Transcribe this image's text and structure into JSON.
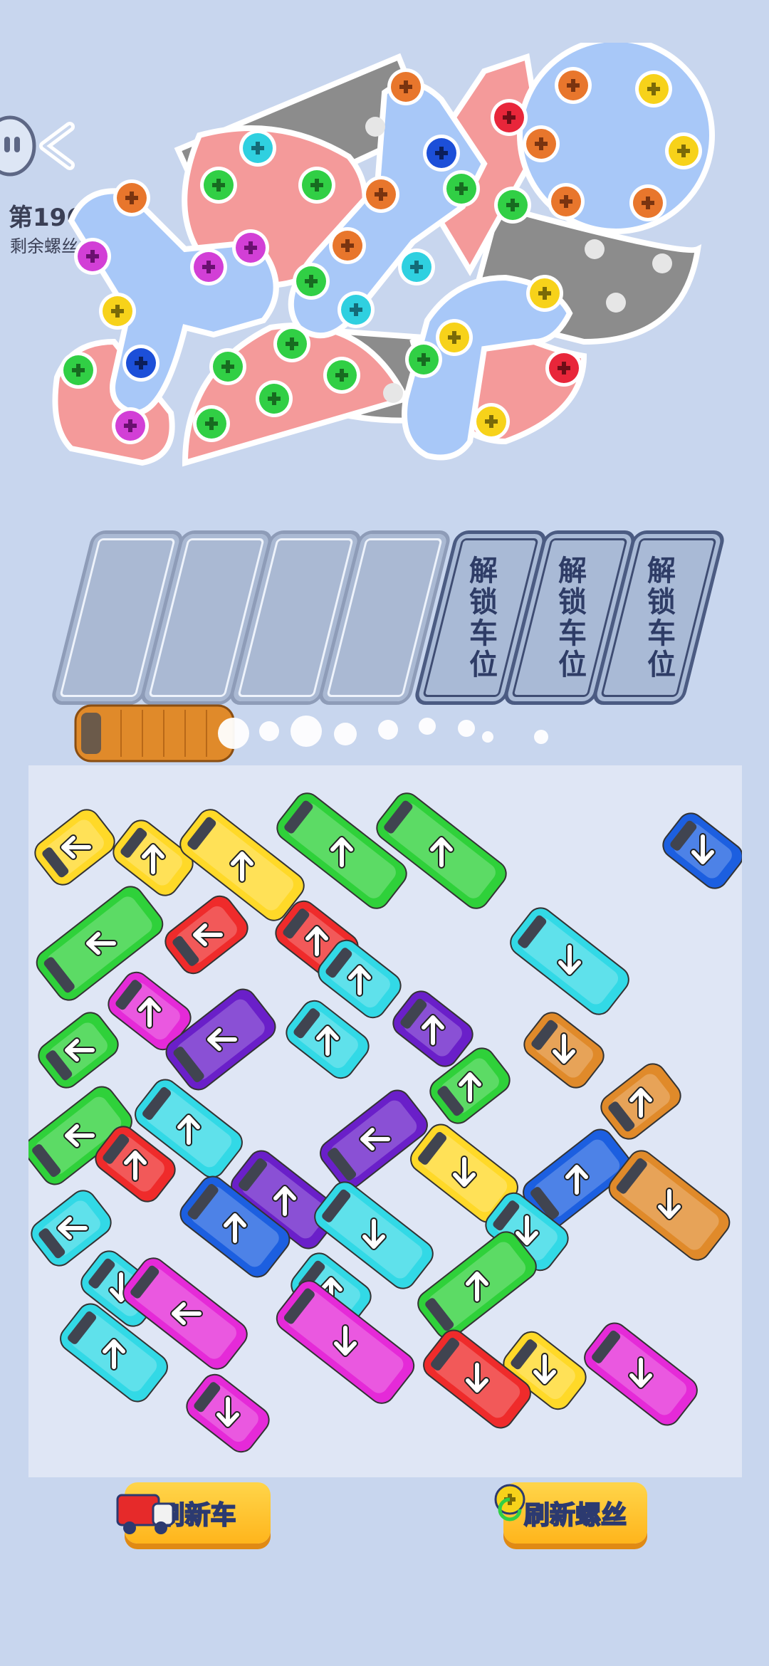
{
  "hud": {
    "level_label": "第1960关",
    "screws_remaining_label": "剩余螺丝153"
  },
  "slots": {
    "empty_count": 4,
    "locked": [
      {
        "label": "解锁车位"
      },
      {
        "label": "解锁车位"
      },
      {
        "label": "解锁车位"
      }
    ]
  },
  "buttons": {
    "refresh_cars": "刷新车",
    "refresh_screws": "刷新螺丝"
  },
  "colors": {
    "background": "#c8d6ee",
    "yard": "#dfe6f5",
    "button_yellow": "#ffc62e",
    "red": "#ef2b2b",
    "green": "#2fd13a",
    "yellow": "#ffd928",
    "cyan": "#32d9e6",
    "purple": "#6a1fc9",
    "magenta": "#e52ad8",
    "blue": "#1c5fe0",
    "orange": "#e08a2a",
    "pink_plate": "#f8a0a0",
    "blue_plate": "#a8c8f8",
    "gray_plate": "#8c8c8c"
  },
  "cars": [
    {
      "color": "yellow",
      "dir": "left"
    },
    {
      "color": "yellow",
      "dir": "up"
    },
    {
      "color": "yellow",
      "dir": "up"
    },
    {
      "color": "green",
      "dir": "up"
    },
    {
      "color": "green",
      "dir": "up"
    },
    {
      "color": "blue",
      "dir": "down"
    },
    {
      "color": "green",
      "dir": "left"
    },
    {
      "color": "red",
      "dir": "left"
    },
    {
      "color": "red",
      "dir": "up"
    },
    {
      "color": "cyan",
      "dir": "up"
    },
    {
      "color": "cyan",
      "dir": "down"
    },
    {
      "color": "magenta",
      "dir": "up"
    },
    {
      "color": "purple",
      "dir": "left"
    },
    {
      "color": "cyan",
      "dir": "up"
    },
    {
      "color": "purple",
      "dir": "up"
    },
    {
      "color": "green",
      "dir": "left"
    },
    {
      "color": "orange",
      "dir": "down"
    },
    {
      "color": "green",
      "dir": "up"
    },
    {
      "color": "green",
      "dir": "left"
    },
    {
      "color": "cyan",
      "dir": "up"
    },
    {
      "color": "purple",
      "dir": "left"
    },
    {
      "color": "orange",
      "dir": "up"
    },
    {
      "color": "red",
      "dir": "up"
    },
    {
      "color": "purple",
      "dir": "up"
    },
    {
      "color": "yellow",
      "dir": "down"
    },
    {
      "color": "blue",
      "dir": "up"
    },
    {
      "color": "orange",
      "dir": "down"
    },
    {
      "color": "cyan",
      "dir": "left"
    },
    {
      "color": "blue",
      "dir": "up"
    },
    {
      "color": "cyan",
      "dir": "down"
    },
    {
      "color": "cyan",
      "dir": "down"
    },
    {
      "color": "green",
      "dir": "up"
    },
    {
      "color": "cyan",
      "dir": "up"
    },
    {
      "color": "cyan",
      "dir": "down"
    },
    {
      "color": "magenta",
      "dir": "left"
    },
    {
      "color": "magenta",
      "dir": "down"
    },
    {
      "color": "cyan",
      "dir": "up"
    },
    {
      "color": "yellow",
      "dir": "down"
    },
    {
      "color": "red",
      "dir": "down"
    },
    {
      "color": "magenta",
      "dir": "down"
    },
    {
      "color": "magenta",
      "dir": "down"
    }
  ],
  "exiting_car": {
    "color": "orange"
  }
}
